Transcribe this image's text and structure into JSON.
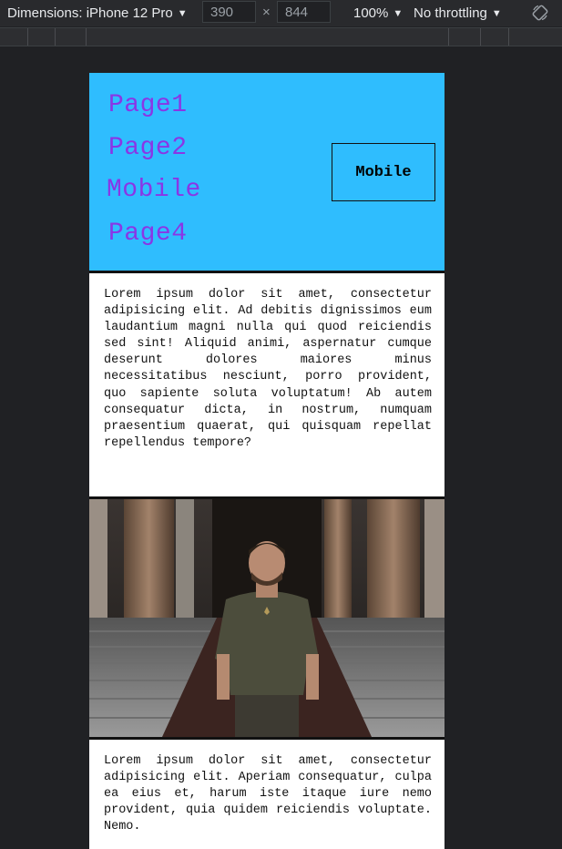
{
  "devtools": {
    "device_label": "Dimensions: iPhone 12 Pro",
    "width_value": "390",
    "height_value": "844",
    "times": "×",
    "zoom": "100%",
    "throttling": "No throttling",
    "caret": "▼"
  },
  "page": {
    "nav": [
      "Page1",
      "Page2",
      "Mobile",
      "Page4"
    ],
    "button_label": "Mobile",
    "paragraph1": "Lorem ipsum dolor sit amet, consectetur adipisicing elit. Ad debitis dignissimos eum laudantium magni nulla qui quod reiciendis sed sint! Aliquid animi, aspernatur cumque deserunt dolores maiores minus necessitatibus nesciunt, porro provident, quo sapiente soluta voluptatum! Ab autem consequatur dicta, in nostrum, numquam praesentium quaerat, qui quisquam repellat repellendus tempore?",
    "paragraph2": "Lorem ipsum dolor sit amet, consectetur adipisicing elit. Aperiam consequatur, culpa ea eius et, harum iste itaque iure nemo provident, quia quidem reiciendis voluptate. Nemo."
  },
  "colors": {
    "header_bg": "#2fbdfe",
    "nav_link": "#8a36e6",
    "devtools_bg": "#292a2d",
    "canvas_bg": "#202124"
  }
}
